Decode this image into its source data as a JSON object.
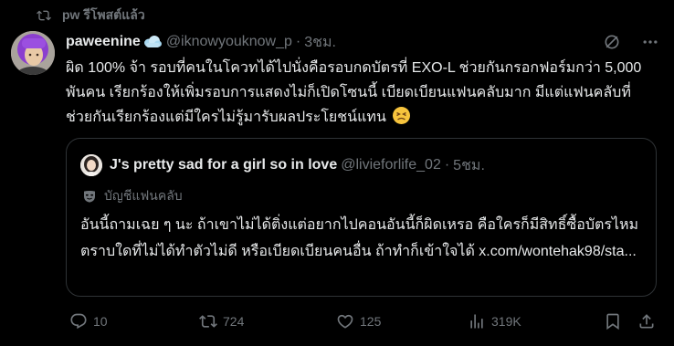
{
  "repost": {
    "text": "pw รีโพสต์แล้ว"
  },
  "author": {
    "display_name": "paweenine",
    "handle": "@iknowyouknow_p",
    "separator": "·",
    "time": "3ชม."
  },
  "tweet": {
    "text": "ผิด 100% จ้า รอบที่คนในโควทได้ไปนั่งคือรอบกดบัตรที่ EXO-L ช่วยกันกรอกฟอร์มกว่า 5,000 พันคน เรียกร้องให้เพิ่มรอบการแสดงไม่ก็เปิดโซนนี้ เบียดเบียนแฟนคลับมาก มีแต่แฟนคลับที่ช่วยกันเรียกร้องแต่มีใครไม่รู้มารับผลประโยชน์แทน"
  },
  "quote": {
    "display_name": "J's pretty sad for a girl so in love",
    "handle": "@livieforlife_02",
    "separator": "·",
    "time": "5ชม.",
    "context_label": "บัญชีแฟนคลับ",
    "text": "อันนี้ถามเฉย ๆ นะ ถ้าเขาไม่ได้ติ่งแต่อยากไปคอนอันนี้ก็ผิดเหรอ คือใครก็มีสิทธิ์ซื้อบัตรไหม ตราบใดที่ไม่ได้ทำตัวไม่ดี หรือเบียดเบียนคนอื่น ถ้าทำก็เข้าใจได้ x.com/wontehak98/sta..."
  },
  "actions": {
    "replies": "10",
    "reposts": "724",
    "likes": "125",
    "views": "319K"
  },
  "icons": {
    "repost_header": "repost-icon",
    "verified": "cloud-emoji-icon",
    "grok": "slash-circle-icon",
    "more": "more-icon",
    "fan_account": "mask-icon",
    "reply": "reply-icon",
    "repost": "repost-icon",
    "like": "heart-icon",
    "views": "views-icon",
    "bookmark": "bookmark-icon",
    "share": "share-icon"
  },
  "colors": {
    "background": "#000000",
    "text_primary": "#e7e9ea",
    "text_secondary": "#71767b",
    "border": "#2f3336",
    "avatar_hair": "#8b3fcf"
  }
}
